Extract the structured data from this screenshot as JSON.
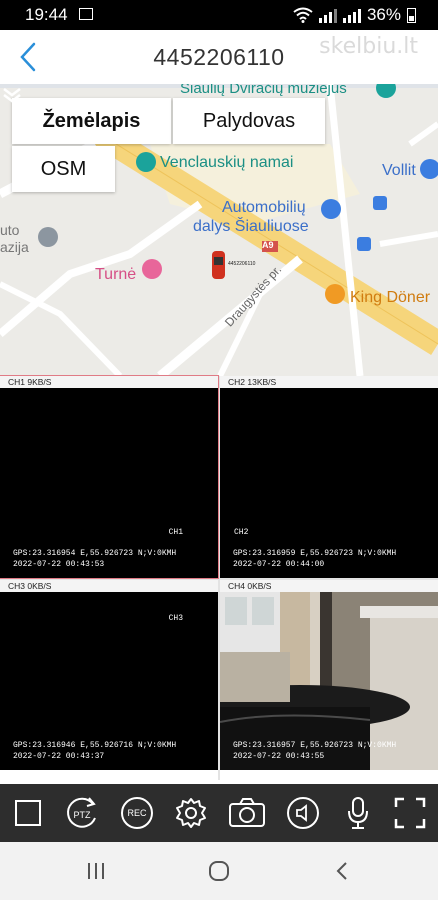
{
  "status": {
    "time": "19:44",
    "battery": "36%"
  },
  "appbar": {
    "title": "4452206110",
    "watermark": "skelbiu.lt"
  },
  "map": {
    "modes": [
      {
        "label": "Žemėlapis",
        "active": true
      },
      {
        "label": "Palydovas",
        "active": false
      },
      {
        "label": "OSM",
        "active": false
      }
    ],
    "pois": [
      {
        "label": "Šiaulių Dviračių muziejus"
      },
      {
        "label": "Venclauskių namai"
      },
      {
        "label": "Vollit"
      },
      {
        "label": "Automobilių"
      },
      {
        "label": "dalys Šiauliuose"
      },
      {
        "label": "Turnė"
      },
      {
        "label": "King Döner"
      },
      {
        "label": "Draugystės pr."
      },
      {
        "label": "A9"
      },
      {
        "label": "uto"
      },
      {
        "label": "azija"
      }
    ],
    "vehicle_label": "4452206110"
  },
  "channels": [
    {
      "header": "CH1 9KB/S",
      "tag": "CH1",
      "gps": "GPS:23.316954 E,55.926723 N;V:0KMH",
      "ts": "2022-07-22 00:43:53",
      "selected": true
    },
    {
      "header": "CH2 13KB/S",
      "tag": "CH2",
      "gps": "GPS:23.316959 E,55.926723 N;V:0KMH",
      "ts": "2022-07-22 00:44:00",
      "selected": false
    },
    {
      "header": "CH3 0KB/S",
      "tag": "CH3",
      "gps": "GPS:23.316946 E,55.926716 N;V:0KMH",
      "ts": "2022-07-22 00:43:37",
      "selected": false
    },
    {
      "header": "CH4 0KB/S",
      "tag": "",
      "gps": "GPS:23.316957 E,55.926723 N;V:0KMH",
      "ts": "2022-07-22 00:43:55",
      "selected": false
    }
  ],
  "toolbar": {
    "rec_label": "REC",
    "ptz_label": "PTZ",
    "icons": [
      "single-view-icon",
      "ptz-icon",
      "record-icon",
      "settings-icon",
      "snapshot-icon",
      "audio-icon",
      "microphone-icon",
      "fullscreen-icon"
    ]
  }
}
